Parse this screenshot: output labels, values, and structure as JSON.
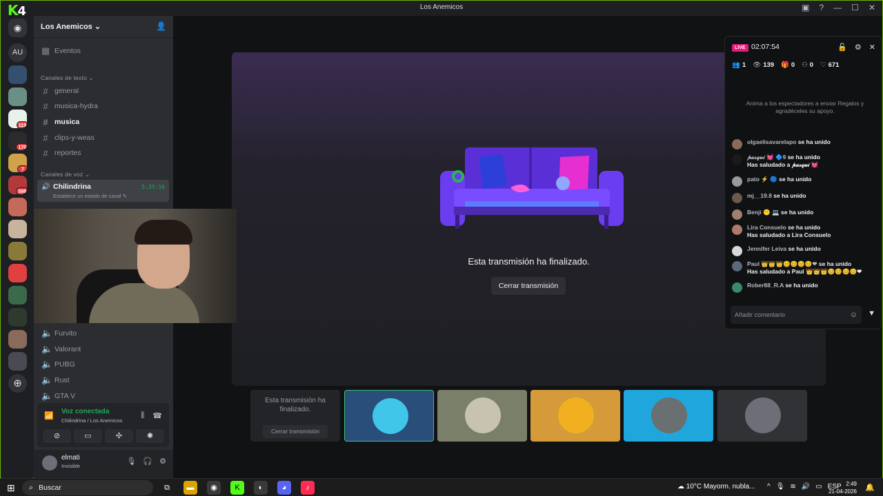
{
  "window": {
    "app_logo": "K",
    "app_logo_num": "4",
    "title": "Los Anemicos"
  },
  "rail": {
    "au_label": "AU",
    "badges": [
      "119",
      "170",
      "7",
      "598"
    ]
  },
  "sidebar": {
    "server_name": "Los Anemicos ⌄",
    "events": "Eventos",
    "text_category": "Canales de texto ⌄",
    "text_channels": [
      "general",
      "musica-hydra",
      "musica",
      "clips-y-weas",
      "reportes"
    ],
    "voice_category": "Canales de voz ⌄",
    "active_voice": {
      "name": "Chilindrina",
      "time": "5:35:16",
      "status": "Establece un estado de canal ✎"
    },
    "voice_channels": [
      "Furvito",
      "Valorant",
      "PUBG",
      "Rust",
      "GTA V"
    ]
  },
  "voice_panel": {
    "title": "Voz conectada",
    "subtitle": "Chilindrina / Los Anemicos"
  },
  "user": {
    "name": "elmati",
    "status": "Invisible"
  },
  "stage": {
    "ended_text": "Esta transmisión ha finalizado.",
    "close_label": "Cerrar transmisión",
    "thumb_ended_text": "Esta transmisión ha finalizado.",
    "thumb_close_label": "Cerrar transmisión"
  },
  "chat": {
    "live_label": "LIVE",
    "timer": "02:07:54",
    "stats": {
      "viewers_in": "1",
      "watching": "139",
      "gifts": "0",
      "follows": "0",
      "likes": "671"
    },
    "encourage": "Anima a los espectadores a enviar Regalos y agradéceles su apoyo.",
    "messages": [
      {
        "user": "olgaelisavarelapo",
        "text": "se ha unido",
        "sub": ""
      },
      {
        "user": "𝓅𝒶𝓈𝓆𝓊𝒾 💓 🔷9",
        "text": "se ha unido",
        "sub": "Has saludado a 𝓅𝒶𝓈𝓆𝓊𝒾 💓"
      },
      {
        "user": "pato ⚡ 🔵",
        "text": "se ha unido",
        "sub": ""
      },
      {
        "user": "mj__19.8",
        "text": "se ha unido",
        "sub": ""
      },
      {
        "user": "Benji 😶 💻",
        "text": "se ha unido",
        "sub": ""
      },
      {
        "user": "Lira Consuelo",
        "text": "se ha unido",
        "sub": "Has saludado a Lira Consuelo"
      },
      {
        "user": "Jennifer Leiva",
        "text": "se ha unido",
        "sub": ""
      },
      {
        "user": "Paul 👑👑👑😊😊😊😊❤",
        "text": "se ha unido",
        "sub": "Has saludado a Paul 👑👑👑😊😊😊😊❤"
      },
      {
        "user": "Rober88_R.A",
        "text": "se ha unido",
        "sub": ""
      }
    ],
    "comment_placeholder": "Añadir comentario"
  },
  "taskbar": {
    "search": "Buscar",
    "weather": "10°C  Mayorm. nubla...",
    "lang": "ESP",
    "time": "2:49",
    "date": "21-04-2026"
  },
  "colors": {
    "kick_green": "#53fc18",
    "discord_green": "#23a55a",
    "live_pink": "#e7197b"
  }
}
